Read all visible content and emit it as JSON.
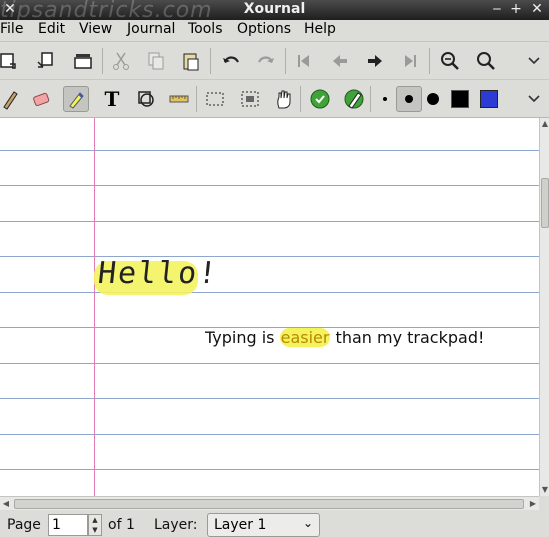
{
  "window": {
    "title": "Xournal",
    "watermark": "tipsandtricks.com"
  },
  "menubar": {
    "items": [
      {
        "label": "File"
      },
      {
        "label": "Edit"
      },
      {
        "label": "View"
      },
      {
        "label": "Journal"
      },
      {
        "label": "Tools"
      },
      {
        "label": "Options"
      },
      {
        "label": "Help"
      }
    ]
  },
  "toolbar1": {
    "icons": [
      "save-icon",
      "new-page-icon",
      "print-icon",
      "cut-icon",
      "copy-icon",
      "paste-icon",
      "undo-icon",
      "redo-icon",
      "first-page-icon",
      "prev-page-icon",
      "next-page-icon",
      "last-page-icon",
      "zoom-out-icon",
      "zoom-in-icon"
    ]
  },
  "toolbar2": {
    "icons": [
      "pen-icon",
      "eraser-icon",
      "highlighter-icon",
      "text-icon",
      "shape-icon",
      "ruler-icon",
      "select-region-icon",
      "select-rectangle-icon",
      "hand-icon",
      "default-tool-icon",
      "default-pen-icon"
    ],
    "colors": {
      "black": "#000000",
      "blue": "#2b3bd4",
      "highlight": "#f4f35e",
      "margin": "#e07bb4",
      "rule": "#8fa7cc"
    }
  },
  "canvas": {
    "handwritten_text": "Hello!",
    "typed_before": "Typing is ",
    "typed_highlight": "easier",
    "typed_after": " than my trackpad!"
  },
  "statusbar": {
    "page_label": "Page",
    "page_value": "1",
    "of_label": "of 1",
    "layer_label": "Layer:",
    "layer_value": "Layer 1"
  }
}
